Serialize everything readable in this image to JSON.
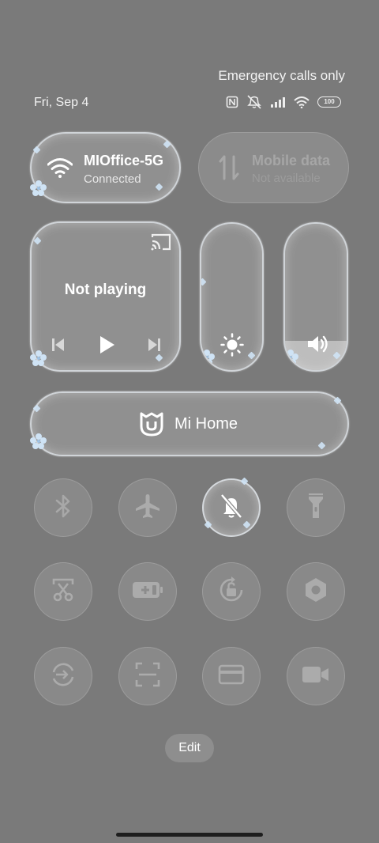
{
  "status_bar": {
    "emergency": "Emergency calls only",
    "date": "Fri, Sep 4",
    "battery": "100",
    "icons": [
      "nfc-icon",
      "vibrate-silent-icon",
      "signal-icon",
      "wifi-icon",
      "battery-icon"
    ]
  },
  "tiles": {
    "wifi": {
      "name": "MIOffice-5G",
      "status": "Connected",
      "icon": "wifi-icon"
    },
    "mobile_data": {
      "name": "Mobile data",
      "status": "Not available",
      "icon": "data-arrows-icon"
    },
    "media": {
      "status": "Not playing",
      "icons": [
        "cast-icon",
        "previous-icon",
        "play-icon",
        "next-icon"
      ]
    },
    "brightness": {
      "icon": "sun-icon",
      "level": 0
    },
    "volume": {
      "icon": "speaker-icon",
      "level": 0.2
    },
    "mi_home": {
      "label": "Mi Home",
      "icon": "mi-home-icon"
    }
  },
  "toggles": [
    {
      "name": "bluetooth",
      "icon": "bluetooth-icon",
      "active": false
    },
    {
      "name": "airplane-mode",
      "icon": "airplane-icon",
      "active": false
    },
    {
      "name": "mute",
      "icon": "bell-off-icon",
      "active": true
    },
    {
      "name": "flashlight",
      "icon": "flashlight-icon",
      "active": false
    },
    {
      "name": "screenshot",
      "icon": "scissors-icon",
      "active": false
    },
    {
      "name": "battery-saver",
      "icon": "battery-plus-icon",
      "active": false
    },
    {
      "name": "auto-rotate",
      "icon": "rotate-lock-icon",
      "active": false
    },
    {
      "name": "settings",
      "icon": "hexagon-gear-icon",
      "active": false
    },
    {
      "name": "sync",
      "icon": "sync-icon",
      "active": false
    },
    {
      "name": "scanner",
      "icon": "scan-icon",
      "active": false
    },
    {
      "name": "card",
      "icon": "card-icon",
      "active": false
    },
    {
      "name": "screen-recorder",
      "icon": "video-camera-icon",
      "active": false
    }
  ],
  "edit_label": "Edit",
  "colors": {
    "background": "#7a7a7a",
    "accent": "#cfe3f5"
  }
}
